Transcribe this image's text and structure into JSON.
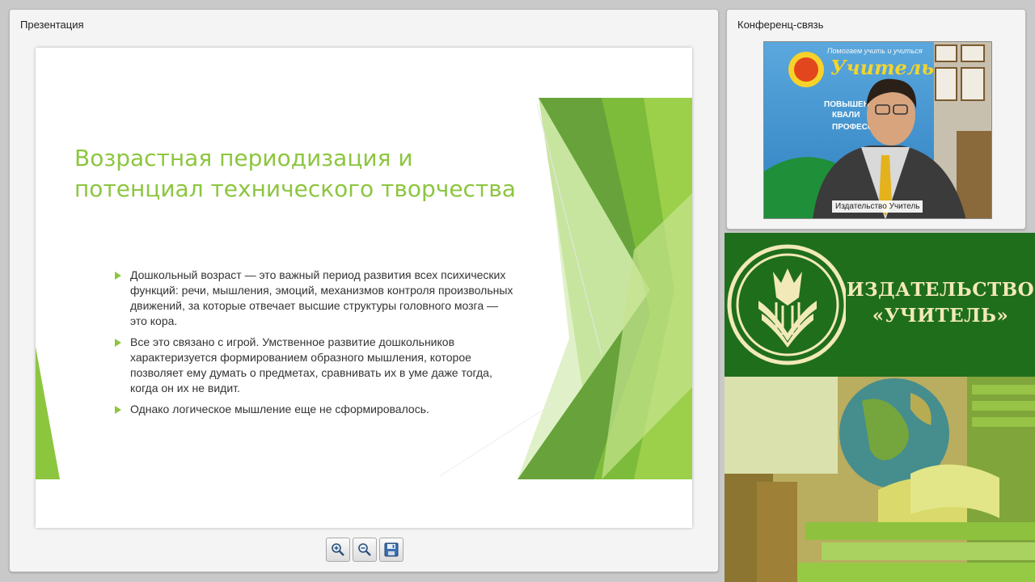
{
  "presentation": {
    "title": "Презентация",
    "slide": {
      "title": "Возрастная периодизация и потенциал технического творчества",
      "bullets": [
        "Дошкольный возраст — это важный период развития всех психических функций: речи, мышления, эмоций, механизмов контроля произвольных движений, за которые отвечает высшие структуры головного мозга — это кора.",
        "Все это связано с игрой. Умственное развитие дошкольников характеризуется формированием образного мышления, которое позволяет ему думать о предметах, сравнивать их в уме даже тогда, когда он их не видит.",
        "Однако логическое мышление еще не сформировалось."
      ]
    },
    "toolbar": {
      "zoom_in_icon": "zoom-in-icon",
      "zoom_out_icon": "zoom-out-icon",
      "save_icon": "floppy-disk-icon"
    }
  },
  "conference": {
    "title": "Конференц-связь",
    "video_label": "Издательство Учитель",
    "backdrop_text": {
      "slogan": "Помогаем учить и учиться",
      "brand": "Учитель",
      "line1": "ПОВЫШЕНИ",
      "line2": "КВАЛИ",
      "line3": "ПРОФЕСС"
    }
  },
  "banner": {
    "publisher_line1": "ИЗДАТЕЛЬСТВО",
    "publisher_line2": "«УЧИТЕЛЬ»"
  },
  "colors": {
    "accent_green": "#8cc63f",
    "banner_green": "#1f6e1c",
    "logo_cream": "#f2e9b8"
  }
}
